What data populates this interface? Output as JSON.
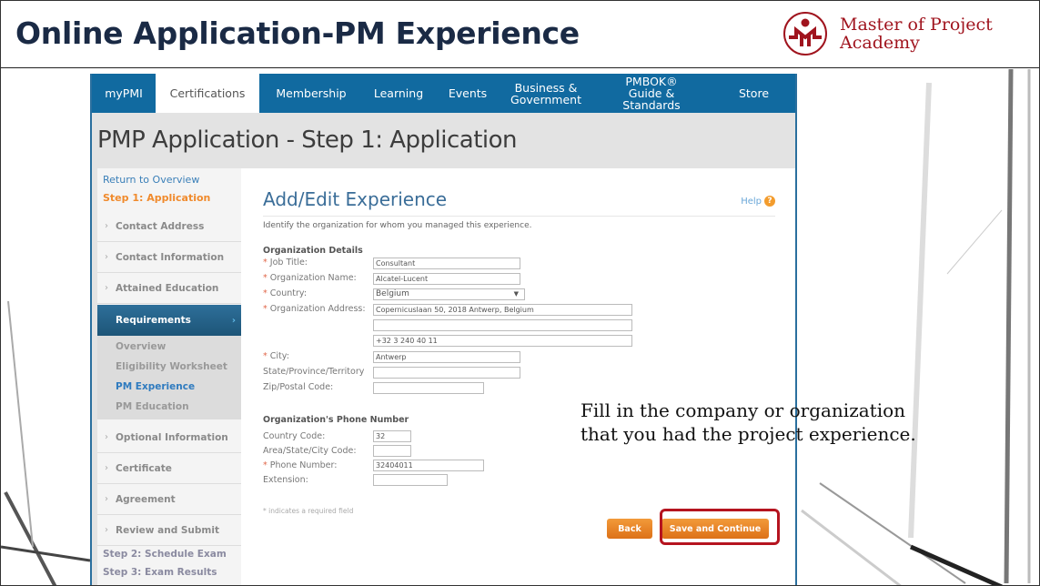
{
  "slide": {
    "title": "Online Application-PM Experience",
    "logo": {
      "line1": "Master of Project",
      "line2": "Academy",
      "color": "#a0141e"
    },
    "callout": "Fill in the company or organization that you had the project experience."
  },
  "nav": {
    "items": [
      {
        "label": "myPMI",
        "active": false
      },
      {
        "label": "Certifications",
        "active": true
      },
      {
        "label": "Membership",
        "active": false
      },
      {
        "label": "Learning",
        "active": false
      },
      {
        "label": "Events",
        "active": false
      },
      {
        "label": "Business & Government",
        "active": false
      },
      {
        "label": "PMBOK® Guide & Standards",
        "active": false
      },
      {
        "label": "Store",
        "active": false
      }
    ],
    "color": "#116aa0"
  },
  "page": {
    "heading": "PMP Application - Step 1: Application"
  },
  "sidebar": {
    "return_link": "Return to Overview",
    "step1": "Step 1: Application",
    "items_top": [
      "Contact Address",
      "Contact Information",
      "Attained Education"
    ],
    "active": "Requirements",
    "sub_items": [
      "Overview",
      "Eligibility Worksheet",
      "PM Experience",
      "PM Education"
    ],
    "current_sub": "PM Experience",
    "items_bottom": [
      "Optional Information",
      "Certificate",
      "Agreement",
      "Review and Submit"
    ],
    "step2": "Step 2: Schedule Exam",
    "step3": "Step 3: Exam Results"
  },
  "form": {
    "title": "Add/Edit Experience",
    "help": "Help",
    "intro": "Identify the organization for whom you managed this experience.",
    "org_section": "Organization Details",
    "fields": {
      "job_title": {
        "label": "Job Title:",
        "value": "Consultant",
        "required": true
      },
      "org_name": {
        "label": "Organization Name:",
        "value": "Alcatel-Lucent",
        "required": true
      },
      "country": {
        "label": "Country:",
        "value": "Belgium",
        "required": true
      },
      "address": {
        "label": "Organization Address:",
        "line1": "Copernicuslaan 50, 2018 Antwerp, Belgium",
        "line2": "",
        "line3": "+32 3 240 40 11",
        "required": true
      },
      "city": {
        "label": "City:",
        "value": "Antwerp",
        "required": true
      },
      "state": {
        "label": "State/Province/Territory",
        "value": ""
      },
      "zip": {
        "label": "Zip/Postal Code:",
        "value": ""
      }
    },
    "phone_section": "Organization's Phone Number",
    "phone": {
      "country_code": {
        "label": "Country Code:",
        "value": "32"
      },
      "area_code": {
        "label": "Area/State/City Code:",
        "value": ""
      },
      "number": {
        "label": "Phone Number:",
        "value": "32404011",
        "required": true
      },
      "extension": {
        "label": "Extension:",
        "value": ""
      }
    },
    "required_note": "* indicates a required field",
    "back_label": "Back",
    "save_label": "Save and Continue"
  }
}
